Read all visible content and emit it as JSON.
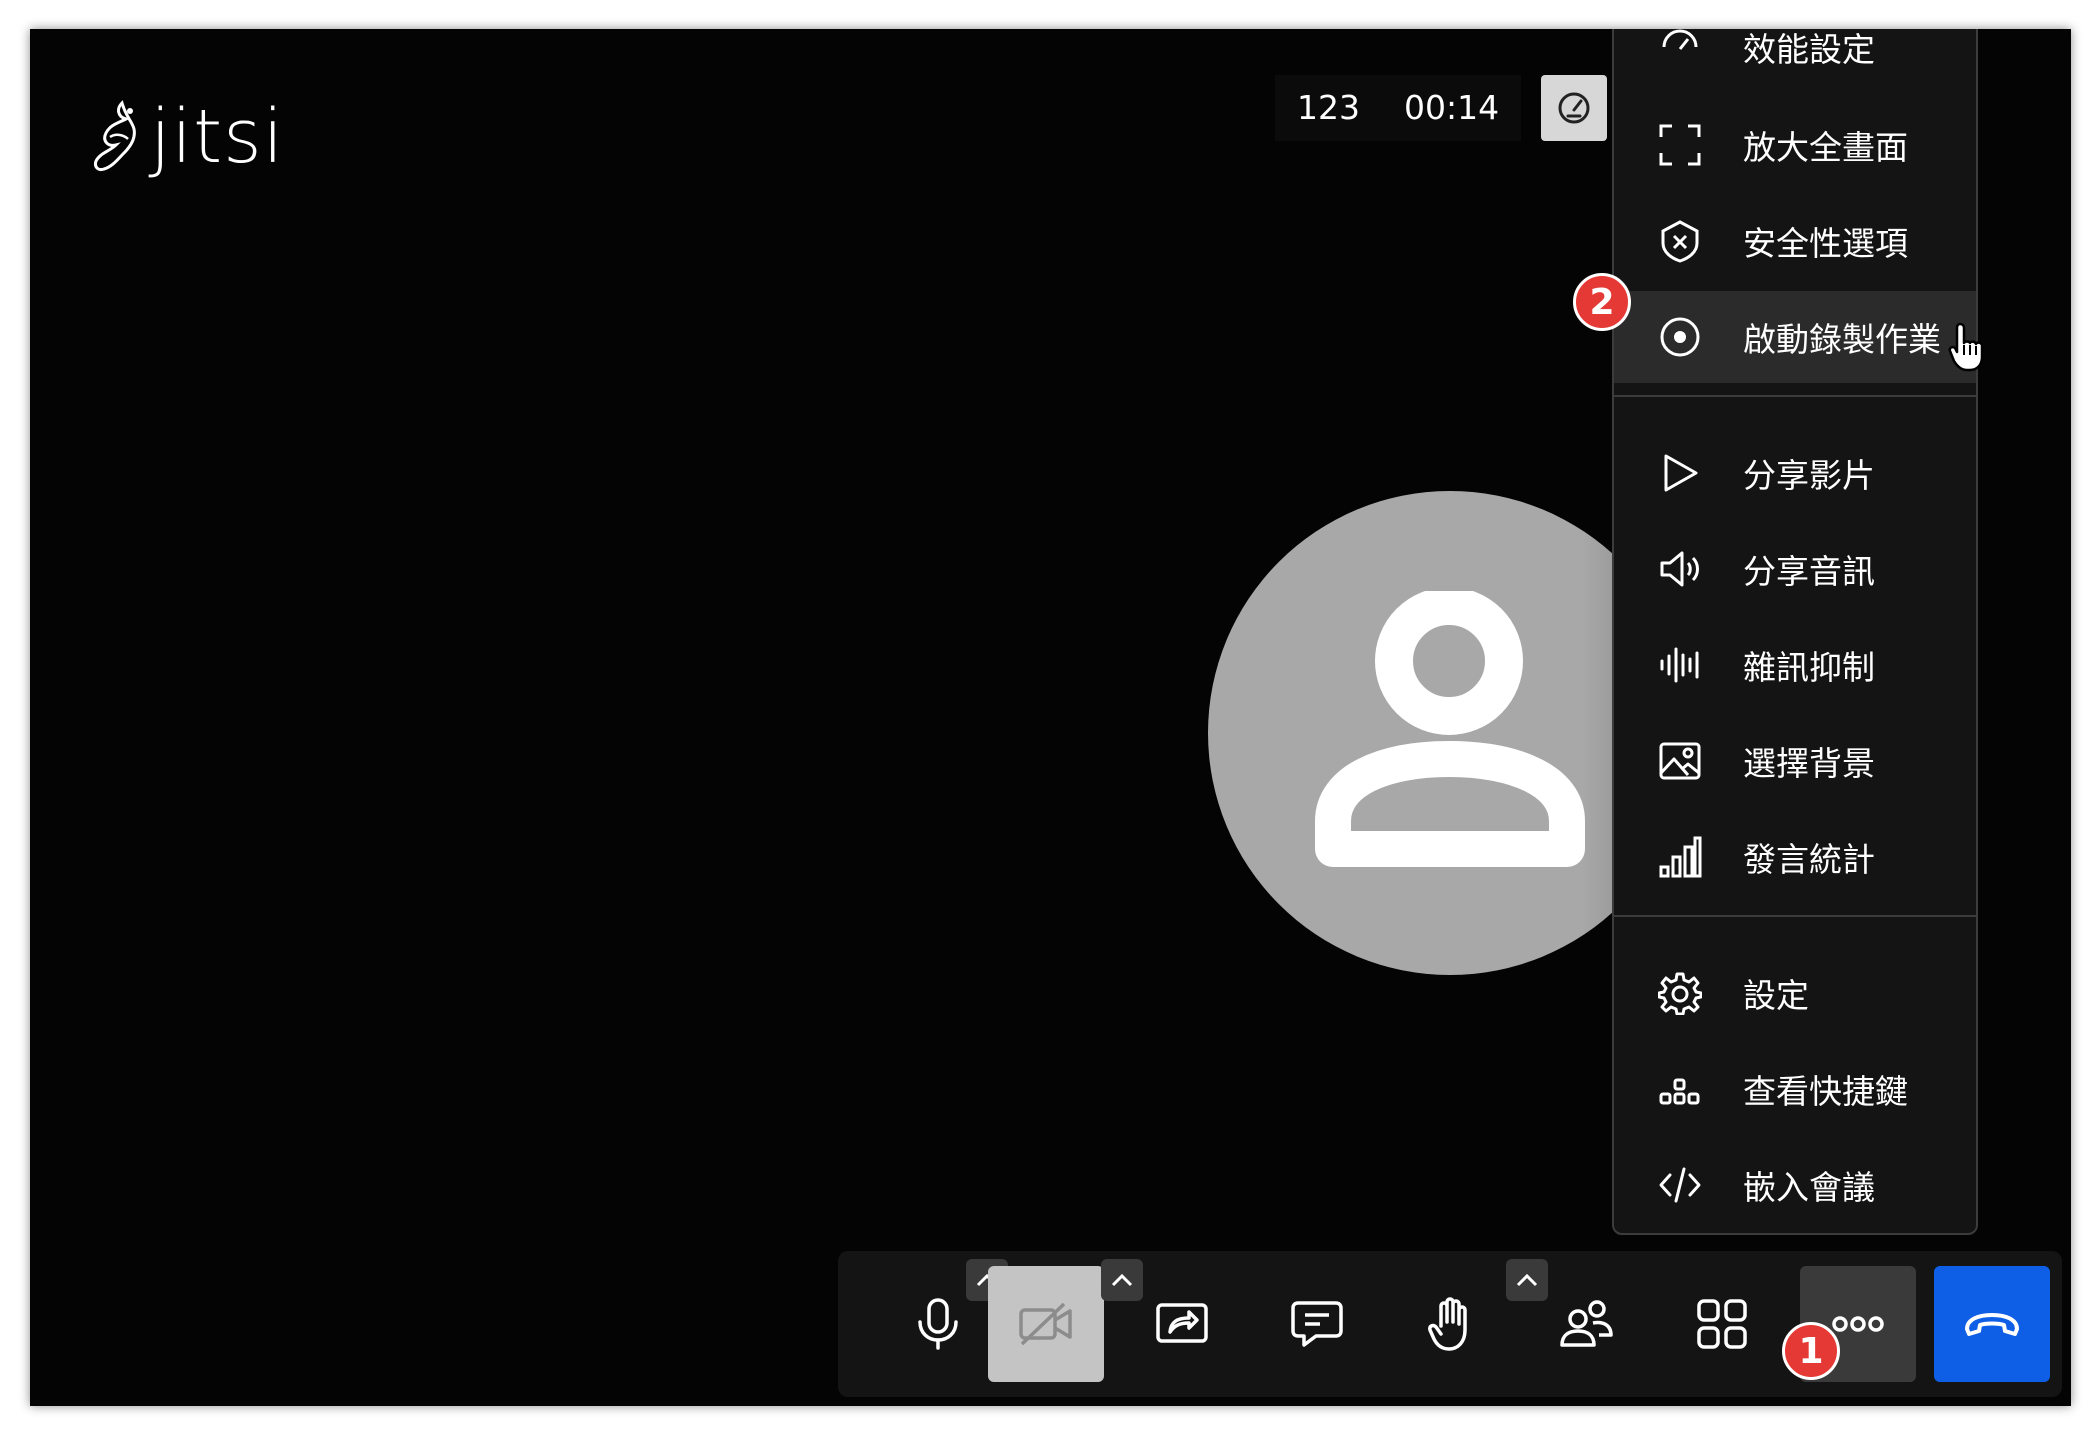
{
  "logo": {
    "text": "jitsi"
  },
  "top_stats": {
    "participants": "123",
    "timer": "00:14",
    "performance_icon": "speedometer-icon"
  },
  "menu": {
    "items": [
      {
        "label": "效能設定",
        "icon": "performance-icon"
      },
      {
        "label": "放大全畫面",
        "icon": "fullscreen-icon"
      },
      {
        "label": "安全性選項",
        "icon": "shield-icon"
      },
      {
        "label": "啟動錄製作業",
        "icon": "record-icon"
      },
      {
        "label": "分享影片",
        "icon": "play-icon"
      },
      {
        "label": "分享音訊",
        "icon": "speaker-icon"
      },
      {
        "label": "雜訊抑制",
        "icon": "noise-suppression-icon"
      },
      {
        "label": "選擇背景",
        "icon": "image-icon"
      },
      {
        "label": "發言統計",
        "icon": "bar-chart-icon"
      },
      {
        "label": "設定",
        "icon": "gear-icon"
      },
      {
        "label": "查看快捷鍵",
        "icon": "shortcuts-icon"
      },
      {
        "label": "嵌入會議",
        "icon": "code-icon"
      }
    ]
  },
  "badges": {
    "step1": "1",
    "step2": "2"
  },
  "toolbar": {
    "buttons": [
      "microphone",
      "camera-off",
      "screen-share",
      "chat",
      "raise-hand",
      "participants",
      "tile-view",
      "more-options",
      "hang-up"
    ]
  },
  "colors": {
    "background": "#040404",
    "menu_bg": "#141414",
    "hangup": "#0f5ee6",
    "badge": "#e53935",
    "avatar": "#a8a8a8"
  }
}
